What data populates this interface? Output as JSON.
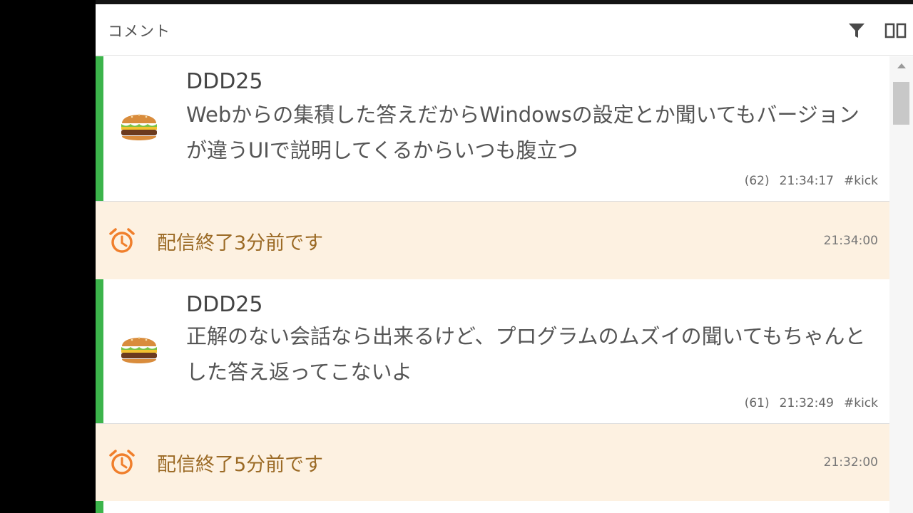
{
  "header": {
    "title": "コメント",
    "filter_icon": "filter-icon",
    "layout_icon": "columns-icon"
  },
  "comments": [
    {
      "author": "DDD25",
      "text": "Webからの集積した答えだからWindowsの設定とか聞いてもバージョンが違うUIで説明してくるからいつも腹立つ",
      "count": "(62)",
      "time": "21:34:17",
      "tag": "#kick",
      "avatar": "hamburger-icon"
    },
    {
      "author": "DDD25",
      "text": "正解のない会話なら出来るけど、プログラムのムズイの聞いてもちゃんとした答え返ってこないよ",
      "count": "(61)",
      "time": "21:32:49",
      "tag": "#kick",
      "avatar": "hamburger-icon"
    }
  ],
  "notices": [
    {
      "text": "配信終了3分前です",
      "time": "21:34:00",
      "icon": "alarm-clock-icon"
    },
    {
      "text": "配信終了5分前です",
      "time": "21:32:00",
      "icon": "alarm-clock-icon"
    }
  ],
  "colors": {
    "accent": "#3cb44b",
    "notice_bg": "#fdf1e1",
    "alarm": "#f07f2c"
  }
}
